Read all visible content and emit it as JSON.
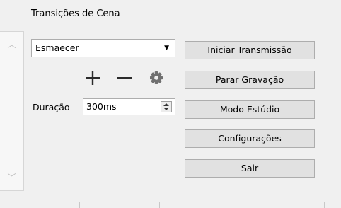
{
  "panel": {
    "title": "Transições de Cena"
  },
  "scrollbar": {
    "up_icon": "chevron-up-icon",
    "down_icon": "chevron-down-icon"
  },
  "transition": {
    "selected": "Esmaecer",
    "add_icon": "plus-icon",
    "remove_icon": "minus-icon",
    "properties_icon": "gear-icon"
  },
  "duration": {
    "label": "Duração",
    "value": "300ms"
  },
  "controls": {
    "start_stream": "Iniciar Transmissão",
    "stop_recording": "Parar Gravação",
    "studio_mode": "Modo Estúdio",
    "settings": "Configurações",
    "exit": "Sair"
  },
  "colors": {
    "window_bg": "#f0f0f0",
    "button_bg": "#e1e1e1",
    "icon": "#2b2b2b",
    "gear": "#707070"
  }
}
